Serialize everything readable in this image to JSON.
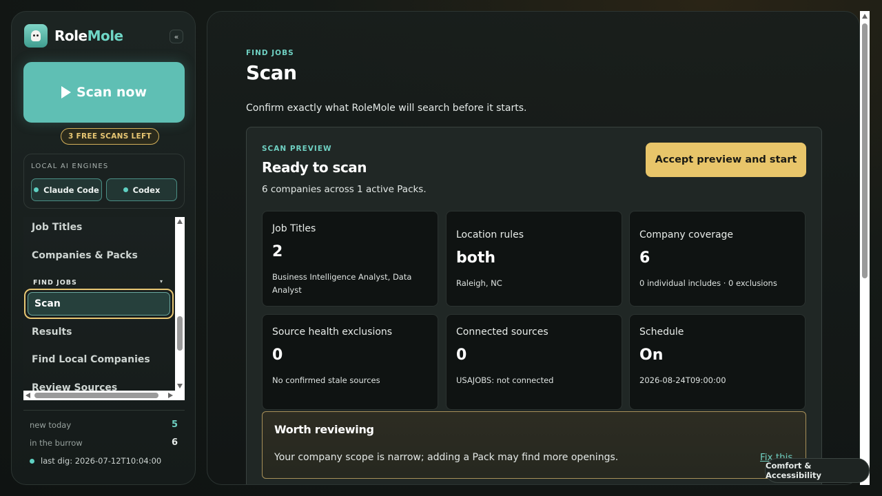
{
  "brand": {
    "name_part1": "Role",
    "name_part2": "Mole",
    "collapse_glyph": "«"
  },
  "sidebar": {
    "scan_now_label": "Scan now",
    "free_scans_badge": "3 FREE SCANS LEFT",
    "engines_title": "LOCAL AI ENGINES",
    "engines": [
      "Claude Code",
      "Codex"
    ],
    "nav_items": [
      "Job Titles",
      "Companies & Packs"
    ],
    "nav_group": "FIND JOBS",
    "active_item": "Scan",
    "group_items": [
      "Results",
      "Find Local Companies",
      "Review Sources"
    ],
    "stats": [
      {
        "label": "new today",
        "value": "5"
      },
      {
        "label": "in the burrow",
        "value": "6"
      }
    ],
    "last_dig": "last dig: 2026-07-12T10:04:00"
  },
  "main": {
    "eyebrow": "FIND JOBS",
    "title": "Scan",
    "subtitle": "Confirm exactly what RoleMole will search before it starts.",
    "preview": {
      "eyebrow": "SCAN PREVIEW",
      "title": "Ready to scan",
      "subtitle": "6 companies across 1 active Packs.",
      "accept_label": "Accept preview and start",
      "cards": [
        {
          "label": "Job Titles",
          "value": "2",
          "note": "Business Intelligence Analyst, Data Analyst"
        },
        {
          "label": "Location rules",
          "value": "both",
          "note": "Raleigh, NC"
        },
        {
          "label": "Company coverage",
          "value": "6",
          "note": "0 individual includes · 0 exclusions"
        },
        {
          "label": "Source health exclusions",
          "value": "0",
          "note": "No confirmed stale sources"
        },
        {
          "label": "Connected sources",
          "value": "0",
          "note": "USAJOBS: not connected"
        },
        {
          "label": "Schedule",
          "value": "On",
          "note": "2026-08-24T09:00:00"
        }
      ],
      "worth": {
        "title": "Worth reviewing",
        "body": "Your company scope is narrow; adding a Pack may find more openings.",
        "fix_label": "Fix this"
      }
    }
  },
  "comfort_label": "Comfort & Accessibility",
  "colors": {
    "accent": "#5fbfb4",
    "gold": "#e8c56a",
    "teal_text": "#6fd0c2"
  }
}
